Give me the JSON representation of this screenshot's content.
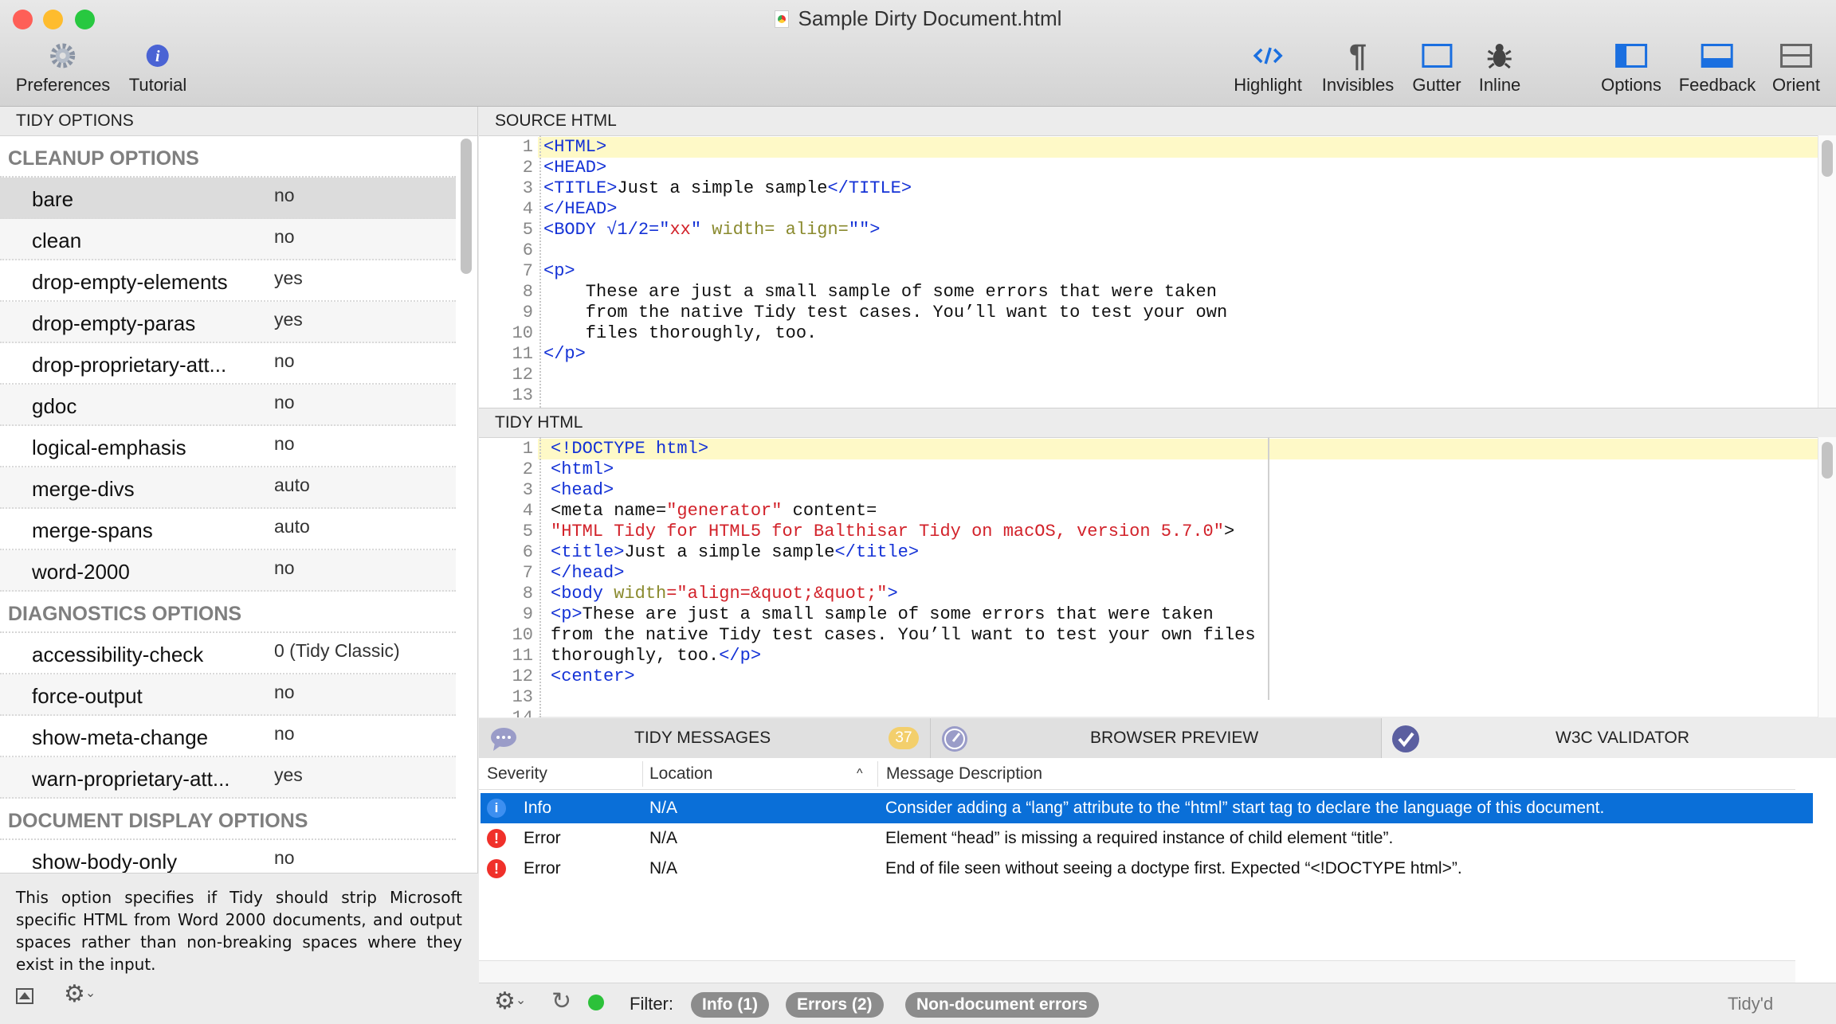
{
  "window": {
    "title": "Sample Dirty Document.html"
  },
  "toolbar": {
    "left": [
      {
        "label": "Preferences",
        "icon": "gear-icon"
      },
      {
        "label": "Tutorial",
        "icon": "info-icon"
      }
    ],
    "right": [
      {
        "label": "Highlight",
        "icon": "code-icon"
      },
      {
        "label": "Invisibles",
        "icon": "pilcrow-icon"
      },
      {
        "label": "Gutter",
        "icon": "gutter-icon"
      },
      {
        "label": "Inline",
        "icon": "bug-icon"
      },
      {
        "label": "Options",
        "icon": "sidebar-left-icon"
      },
      {
        "label": "Feedback",
        "icon": "panel-bottom-icon"
      },
      {
        "label": "Orient",
        "icon": "split-horizontal-icon"
      }
    ]
  },
  "options": {
    "header": "TIDY OPTIONS",
    "sections": [
      {
        "title": "CLEANUP OPTIONS",
        "items": [
          {
            "name": "bare",
            "value": "no",
            "selected": true
          },
          {
            "name": "clean",
            "value": "no"
          },
          {
            "name": "drop-empty-elements",
            "value": "yes"
          },
          {
            "name": "drop-empty-paras",
            "value": "yes"
          },
          {
            "name": "drop-proprietary-att...",
            "value": "no"
          },
          {
            "name": "gdoc",
            "value": "no"
          },
          {
            "name": "logical-emphasis",
            "value": "no"
          },
          {
            "name": "merge-divs",
            "value": "auto"
          },
          {
            "name": "merge-spans",
            "value": "auto"
          },
          {
            "name": "word-2000",
            "value": "no"
          }
        ]
      },
      {
        "title": "DIAGNOSTICS OPTIONS",
        "items": [
          {
            "name": "accessibility-check",
            "value": "0 (Tidy Classic)"
          },
          {
            "name": "force-output",
            "value": "no"
          },
          {
            "name": "show-meta-change",
            "value": "no"
          },
          {
            "name": "warn-proprietary-att...",
            "value": "yes"
          }
        ]
      },
      {
        "title": "DOCUMENT DISPLAY OPTIONS",
        "items": [
          {
            "name": "show-body-only",
            "value": "no"
          }
        ]
      }
    ],
    "description": "This option specifies if Tidy should strip Microsoft specific HTML from Word 2000 documents, and output spaces rather than non-breaking spaces where they exist in the input."
  },
  "source": {
    "header": "SOURCE HTML",
    "lines": [
      [
        [
          "<HTML>",
          "tag"
        ]
      ],
      [
        [
          "<HEAD>",
          "tag"
        ]
      ],
      [
        [
          "<TITLE>",
          "tag"
        ],
        [
          "Just a simple sample",
          "txt"
        ],
        [
          "</TITLE>",
          "tag"
        ]
      ],
      [
        [
          "</HEAD>",
          "tag"
        ]
      ],
      [
        [
          "<BODY √1/2=\"",
          "tag"
        ],
        [
          "xx",
          "str"
        ],
        [
          "\" ",
          "tag"
        ],
        [
          "width= align=",
          "attr"
        ],
        [
          "\"\">",
          "tag"
        ]
      ],
      [],
      [
        [
          "<p>",
          "tag"
        ]
      ],
      [
        [
          "    These are just a small sample of some errors that were taken",
          "txt"
        ]
      ],
      [
        [
          "    from the native Tidy test cases. You’ll want to test your own",
          "txt"
        ]
      ],
      [
        [
          "    files thoroughly, too.",
          "txt"
        ]
      ],
      [
        [
          "</p>",
          "tag"
        ]
      ],
      [],
      []
    ]
  },
  "tidy": {
    "header": "TIDY HTML",
    "lines": [
      [
        [
          "<!DOCTYPE html>",
          "tag"
        ]
      ],
      [
        [
          "<html>",
          "tag"
        ]
      ],
      [
        [
          "<head>",
          "tag"
        ]
      ],
      [
        [
          "<meta name=",
          "txt"
        ],
        [
          "\"generator\"",
          "str"
        ],
        [
          " content=",
          "txt"
        ]
      ],
      [
        [
          "\"HTML Tidy for HTML5 for Balthisar Tidy on macOS, version 5.7.0\"",
          "str"
        ],
        [
          ">",
          "txt"
        ]
      ],
      [
        [
          "<title>",
          "tag"
        ],
        [
          "Just a simple sample",
          "txt"
        ],
        [
          "</title>",
          "tag"
        ]
      ],
      [
        [
          "</head>",
          "tag"
        ]
      ],
      [
        [
          "<body ",
          "tag"
        ],
        [
          "width",
          "attr"
        ],
        [
          "=\"align=&quot;&quot;\"",
          "str"
        ],
        [
          ">",
          "tag"
        ]
      ],
      [
        [
          "<p>",
          "tag"
        ],
        [
          "These are just a small sample of some errors that were taken",
          "txt"
        ]
      ],
      [
        [
          "from the native Tidy test cases. You’ll want to test your own files",
          "txt"
        ]
      ],
      [
        [
          "thoroughly, too.",
          "txt"
        ],
        [
          "</p>",
          "tag"
        ]
      ],
      [
        [
          "<center>",
          "tag"
        ]
      ],
      [],
      []
    ]
  },
  "tabs": [
    {
      "label": "TIDY MESSAGES",
      "badge": "37",
      "icon": "speech-bubble-icon"
    },
    {
      "label": "BROWSER PREVIEW",
      "icon": "compass-icon"
    },
    {
      "label": "W3C VALIDATOR",
      "icon": "checkmark-icon"
    }
  ],
  "messages": {
    "columns": [
      "Severity",
      "Location",
      "Message Description"
    ],
    "rows": [
      {
        "severity": "Info",
        "location": "N/A",
        "message": "Consider adding a “lang” attribute to the “html” start tag to declare the language of this document.",
        "selected": true
      },
      {
        "severity": "Error",
        "location": "N/A",
        "message": "Element “head” is missing a required instance of child element “title”."
      },
      {
        "severity": "Error",
        "location": "N/A",
        "message": "End of file seen without seeing a doctype first. Expected “<!DOCTYPE html>”."
      }
    ]
  },
  "footer": {
    "filter_label": "Filter:",
    "filters": [
      "Info (1)",
      "Errors (2)",
      "Non-document errors"
    ],
    "status": "Tidy'd"
  },
  "colors": {
    "accent": "#0a6fd8",
    "selection": "#0a6fd8",
    "tag": "#1432d6",
    "string": "#d2222a",
    "attr": "#8a8a2e",
    "error": "#f0302a",
    "badge": "#f3cf6c"
  }
}
